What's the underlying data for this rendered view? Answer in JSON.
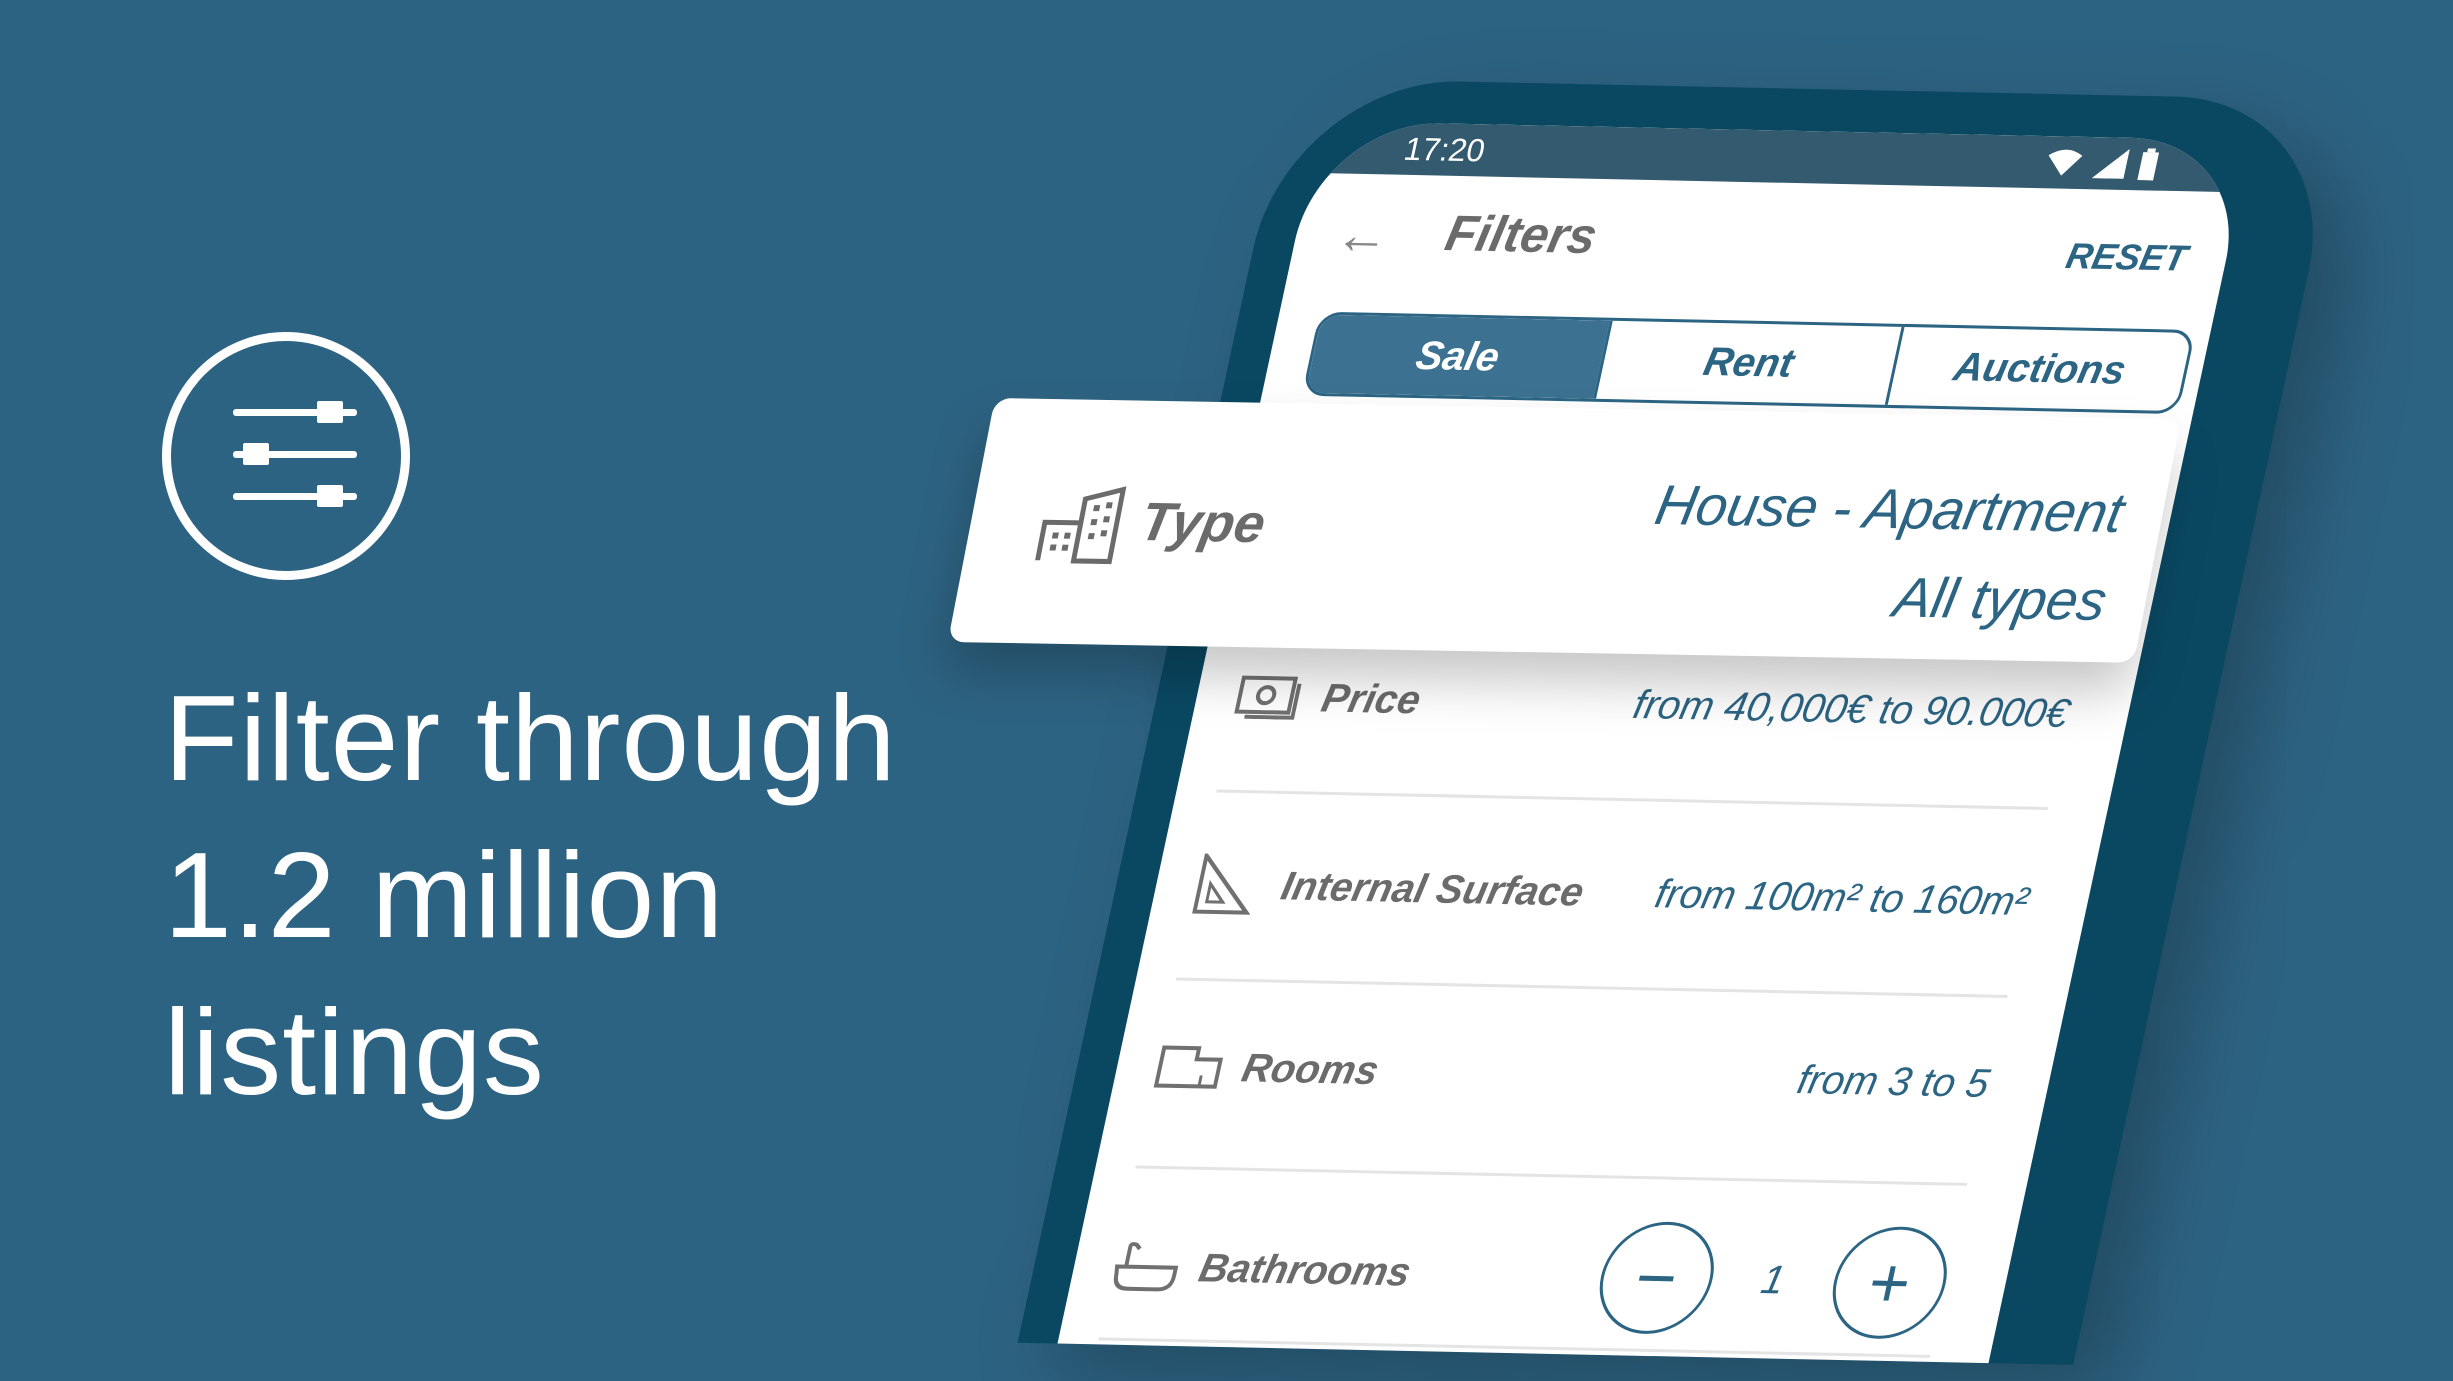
{
  "colors": {
    "background": "#2d6382",
    "phone_body": "#0a4862",
    "accent": "#2c6584",
    "active_tab": "#3d7191"
  },
  "promo": {
    "icon": "sliders-icon",
    "headline": [
      "Filter through",
      "1.2 million",
      "listings"
    ]
  },
  "status_bar": {
    "time": "17:20",
    "icons": [
      "wifi-icon",
      "signal-icon",
      "battery-icon"
    ]
  },
  "header": {
    "back_icon": "arrow-left-icon",
    "title": "Filters",
    "reset_label": "RESET"
  },
  "tabs": [
    {
      "label": "Sale",
      "active": true
    },
    {
      "label": "Rent",
      "active": false
    },
    {
      "label": "Auctions",
      "active": false
    }
  ],
  "type_card": {
    "icon": "buildings-icon",
    "label": "Type",
    "value_line1": "House - Apartment",
    "value_line2": "All types"
  },
  "filters": [
    {
      "icon": "banknote-icon",
      "label": "Price",
      "value": "from 40,000€ to 90.000€"
    },
    {
      "icon": "set-square-icon",
      "label": "Internal Surface",
      "value": "from 100m² to 160m²"
    },
    {
      "icon": "floorplan-icon",
      "label": "Rooms",
      "value": "from 3 to 5"
    }
  ],
  "bathrooms": {
    "icon": "bathtub-icon",
    "label": "Bathrooms",
    "value": "1",
    "minus": "−",
    "plus": "+"
  }
}
